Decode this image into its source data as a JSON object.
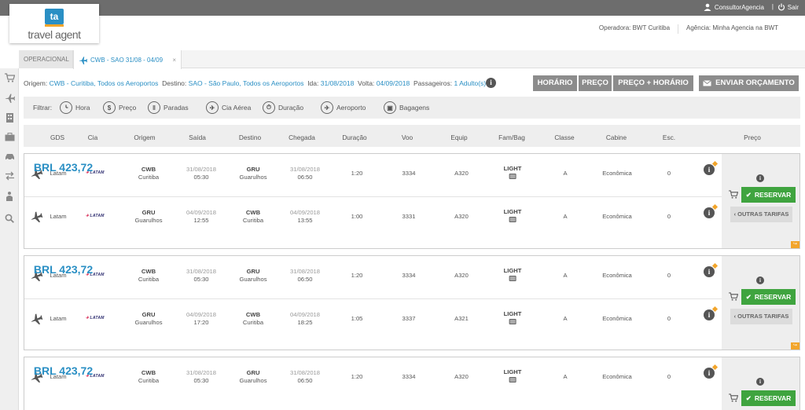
{
  "topbar": {
    "user": "ConsultorAgencia",
    "separator": "|",
    "logout": "Sair"
  },
  "logo": {
    "mark": "ta",
    "text": "travel agent"
  },
  "header": {
    "operadora_label": "Operadora:",
    "operadora": "BWT Curitiba",
    "agencia_label": "Agência:",
    "agencia": "Minha Agencia na BWT"
  },
  "tabs": {
    "operacional": "OPERACIONAL",
    "search_tab": "CWB - SAO 31/08 - 04/09",
    "close": "×"
  },
  "search": {
    "origem_label": "Origem:",
    "origem": "CWB - Curitiba, Todos os Aeroportos",
    "destino_label": "Destino:",
    "destino": "SAO - São Paulo, Todos os Aeroportos",
    "ida_label": "Ida:",
    "ida": "31/08/2018",
    "volta_label": "Volta:",
    "volta": "04/09/2018",
    "passageiros_label": "Passageiros:",
    "passageiros": "1 Adulto(s)"
  },
  "sort_buttons": {
    "horario": "HORÁRIO",
    "preco": "PREÇO",
    "preco_horario": "PREÇO + HORÁRIO"
  },
  "send_button": "ENVIAR ORÇAMENTO",
  "filters": {
    "label": "Filtrar:",
    "hora": "Hora",
    "preco": "Preço",
    "paradas": "Paradas",
    "cia": "Cia Aérea",
    "duracao": "Duração",
    "aeroporto": "Aeroporto",
    "bagagens": "Bagagens"
  },
  "columns": {
    "gds": "GDS",
    "cia": "Cia",
    "origem": "Origem",
    "saida": "Saída",
    "destino": "Destino",
    "chegada": "Chegada",
    "duracao": "Duração",
    "voo": "Voo",
    "equip": "Equip",
    "fambag": "Fam/Bag",
    "classe": "Classe",
    "cabine": "Cabine",
    "esc": "Esc.",
    "preco": "Preço"
  },
  "airline_logo": "LATAM",
  "reservar": "RESERVAR",
  "outras": "OUTRAS TARIFAS",
  "info_glyph": "i",
  "results": [
    {
      "price": "BRL 423,72",
      "segments": [
        {
          "gds": "Latam",
          "orig_code": "CWB",
          "orig_city": "Curitiba",
          "dep_date": "31/08/2018",
          "dep_time": "05:30",
          "dest_code": "GRU",
          "dest_city": "Guarulhos",
          "arr_date": "31/08/2018",
          "arr_time": "06:50",
          "duration": "1:20",
          "flight": "3334",
          "equip": "A320",
          "fam": "LIGHT",
          "classe": "A",
          "cabine": "Econômica",
          "esc": "0"
        },
        {
          "gds": "Latam",
          "orig_code": "GRU",
          "orig_city": "Guarulhos",
          "dep_date": "04/09/2018",
          "dep_time": "12:55",
          "dest_code": "CWB",
          "dest_city": "Curitiba",
          "arr_date": "04/09/2018",
          "arr_time": "13:55",
          "duration": "1:00",
          "flight": "3331",
          "equip": "A320",
          "fam": "LIGHT",
          "classe": "A",
          "cabine": "Econômica",
          "esc": "0"
        }
      ]
    },
    {
      "price": "BRL 423,72",
      "segments": [
        {
          "gds": "Latam",
          "orig_code": "CWB",
          "orig_city": "Curitiba",
          "dep_date": "31/08/2018",
          "dep_time": "05:30",
          "dest_code": "GRU",
          "dest_city": "Guarulhos",
          "arr_date": "31/08/2018",
          "arr_time": "06:50",
          "duration": "1:20",
          "flight": "3334",
          "equip": "A320",
          "fam": "LIGHT",
          "classe": "A",
          "cabine": "Econômica",
          "esc": "0"
        },
        {
          "gds": "Latam",
          "orig_code": "GRU",
          "orig_city": "Guarulhos",
          "dep_date": "04/09/2018",
          "dep_time": "17:20",
          "dest_code": "CWB",
          "dest_city": "Curitiba",
          "arr_date": "04/09/2018",
          "arr_time": "18:25",
          "duration": "1:05",
          "flight": "3337",
          "equip": "A321",
          "fam": "LIGHT",
          "classe": "A",
          "cabine": "Econômica",
          "esc": "0"
        }
      ]
    },
    {
      "price": "BRL 423,72",
      "segments": [
        {
          "gds": "Latam",
          "orig_code": "CWB",
          "orig_city": "Curitiba",
          "dep_date": "31/08/2018",
          "dep_time": "05:30",
          "dest_code": "GRU",
          "dest_city": "Guarulhos",
          "arr_date": "31/08/2018",
          "arr_time": "06:50",
          "duration": "1:20",
          "flight": "3334",
          "equip": "A320",
          "fam": "LIGHT",
          "classe": "A",
          "cabine": "Econômica",
          "esc": "0"
        }
      ]
    }
  ]
}
